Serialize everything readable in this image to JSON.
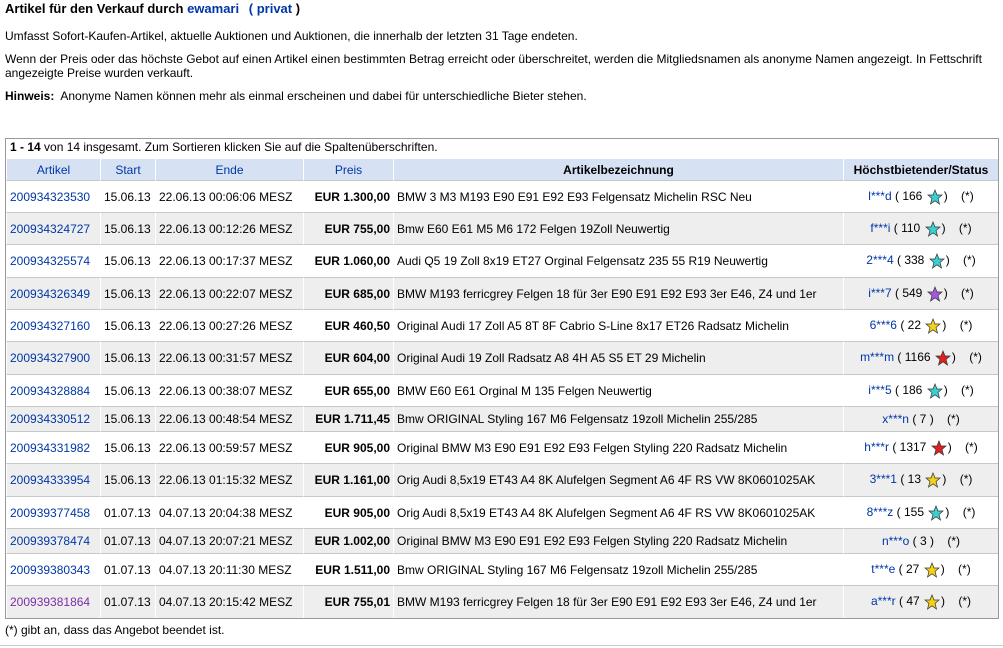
{
  "header": {
    "title_prefix": "Artikel für den Verkauf durch",
    "seller": "ewamari",
    "privat_open": "(",
    "privat": "privat",
    "privat_close": ")"
  },
  "info": {
    "line1": "Umfasst Sofort-Kaufen-Artikel, aktuelle Auktionen und Auktionen, die innerhalb der letzten 31 Tage endeten.",
    "line2": "Wenn der Preis oder das höchste Gebot auf einen Artikel einen bestimmten Betrag erreicht oder überschreitet, werden die Mitgliedsnamen als anonyme Namen angezeigt. In Fettschrift angezeigte Preise wurden verkauft.",
    "hint_label": "Hinweis:",
    "hint_text": "Anonyme Namen können mehr als einmal erscheinen und dabei für unterschiedliche Bieter stehen."
  },
  "summary": {
    "range": "1 - 14",
    "text": "von 14 insgesamt. Zum Sortieren klicken Sie auf die Spaltenüberschriften."
  },
  "columns": {
    "artikel": "Artikel",
    "start": "Start",
    "ende": "Ende",
    "preis": "Preis",
    "bezeichnung": "Artikelbezeichnung",
    "status": "Höchstbietender/Status"
  },
  "rows": [
    {
      "id": "200934323530",
      "start": "15.06.13",
      "end": "22.06.13 00:06:06 MESZ",
      "price": "EUR 1.300,00",
      "title": "BMW 3 M3 M193 E90 E91 E92 E93 Felgensatz Michelin RSC Neu",
      "bidder": "l***d",
      "score": "166",
      "star": "#3ccfcf",
      "status": "(*)"
    },
    {
      "id": "200934324727",
      "start": "15.06.13",
      "end": "22.06.13 00:12:26 MESZ",
      "price": "EUR 755,00",
      "title": "Bmw E60 E61 M5 M6 172 Felgen 19Zoll Neuwertig",
      "bidder": "f***i",
      "score": "110",
      "star": "#3ccfcf",
      "status": "(*)"
    },
    {
      "id": "200934325574",
      "start": "15.06.13",
      "end": "22.06.13 00:17:37 MESZ",
      "price": "EUR 1.060,00",
      "title": "Audi Q5 19 Zoll 8x19 ET27 Orginal Felgensatz 235 55 R19 Neuwertig",
      "bidder": "2***4",
      "score": "338",
      "star": "#3ccfcf",
      "status": "(*)"
    },
    {
      "id": "200934326349",
      "start": "15.06.13",
      "end": "22.06.13 00:22:07 MESZ",
      "price": "EUR 685,00",
      "title": "BMW M193 ferricgrey Felgen 18 für 3er E90 E91 E92 E93 3er E46, Z4 und 1er",
      "bidder": "i***7",
      "score": "549",
      "star": "#a45ae0",
      "status": "(*)"
    },
    {
      "id": "200934327160",
      "start": "15.06.13",
      "end": "22.06.13 00:27:26 MESZ",
      "price": "EUR 460,50",
      "title": "Original Audi 17 Zoll A5 8T 8F Cabrio S-Line 8x17 ET26 Radsatz Michelin",
      "bidder": "6***6",
      "score": "22",
      "star": "#f2d21a",
      "status": "(*)"
    },
    {
      "id": "200934327900",
      "start": "15.06.13",
      "end": "22.06.13 00:31:57 MESZ",
      "price": "EUR 604,00",
      "title": "Original Audi 19 Zoll Radsatz A8 4H A5 S5 ET 29 Michelin",
      "bidder": "m***m",
      "score": "1166",
      "star": "#e02020",
      "status": "(*)"
    },
    {
      "id": "200934328884",
      "start": "15.06.13",
      "end": "22.06.13 00:38:07 MESZ",
      "price": "EUR 655,00",
      "title": "BMW E60 E61 Orginal M 135 Felgen Neuwertig",
      "bidder": "i***5",
      "score": "186",
      "star": "#3ccfcf",
      "status": "(*)"
    },
    {
      "id": "200934330512",
      "start": "15.06.13",
      "end": "22.06.13 00:48:54 MESZ",
      "price": "EUR 1.711,45",
      "title": "Bmw ORIGINAL Styling 167 M6 Felgensatz 19zoll Michelin 255/285",
      "bidder": "x***n",
      "score": "7",
      "star": "",
      "status": "(*)"
    },
    {
      "id": "200934331982",
      "start": "15.06.13",
      "end": "22.06.13 00:59:57 MESZ",
      "price": "EUR 905,00",
      "title": "Original BMW M3 E90 E91 E92 E93 Felgen Styling 220 Radsatz Michelin",
      "bidder": "h***r",
      "score": "1317",
      "star": "#e02020",
      "status": "(*)"
    },
    {
      "id": "200934333954",
      "start": "15.06.13",
      "end": "22.06.13 01:15:32 MESZ",
      "price": "EUR 1.161,00",
      "title": "Orig Audi 8,5x19 ET43 A4 8K Alufelgen Segment A6 4F RS VW 8K0601025AK",
      "bidder": "3***1",
      "score": "13",
      "star": "#f2d21a",
      "status": "(*)"
    },
    {
      "id": "200939377458",
      "start": "01.07.13",
      "end": "04.07.13 20:04:38 MESZ",
      "price": "EUR 905,00",
      "title": "Orig Audi 8,5x19 ET43 A4 8K Alufelgen Segment A6 4F RS VW 8K0601025AK",
      "bidder": "8***z",
      "score": "155",
      "star": "#3ccfcf",
      "status": "(*)"
    },
    {
      "id": "200939378474",
      "start": "01.07.13",
      "end": "04.07.13 20:07:21 MESZ",
      "price": "EUR 1.002,00",
      "title": "Original BMW M3 E90 E91 E92 E93 Felgen Styling 220 Radsatz Michelin",
      "bidder": "n***o",
      "score": "3",
      "star": "",
      "status": "(*)"
    },
    {
      "id": "200939380343",
      "start": "01.07.13",
      "end": "04.07.13 20:11:30 MESZ",
      "price": "EUR 1.511,00",
      "title": "Bmw ORIGINAL Styling 167 M6 Felgensatz 19zoll Michelin 255/285",
      "bidder": "t***e",
      "score": "27",
      "star": "#f2d21a",
      "status": "(*)"
    },
    {
      "id": "200939381864",
      "start": "01.07.13",
      "end": "04.07.13 20:15:42 MESZ",
      "price": "EUR 755,01",
      "title": "BMW M193 ferricgrey Felgen 18 für 3er E90 E91 E92 E93 3er E46, Z4 und 1er",
      "bidder": "a***r",
      "score": "47",
      "star": "#f2d21a",
      "status": "(*)",
      "visited": true
    }
  ],
  "footnote": "(*) gibt an, dass das Angebot beendet ist."
}
